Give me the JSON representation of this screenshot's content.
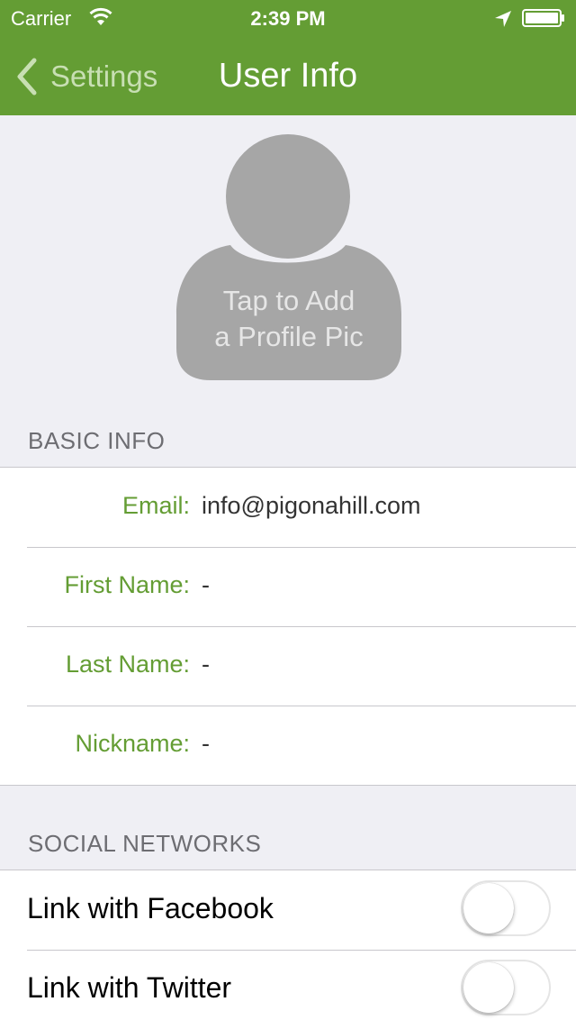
{
  "status_bar": {
    "carrier": "Carrier",
    "time": "2:39 PM"
  },
  "nav": {
    "back_label": "Settings",
    "title": "User Info"
  },
  "profile": {
    "placeholder_text": "Tap to Add\na Profile Pic"
  },
  "basic_info": {
    "header": "BASIC INFO",
    "rows": [
      {
        "label": "Email:",
        "value": "info@pigonahill.com"
      },
      {
        "label": "First Name:",
        "value": "-"
      },
      {
        "label": "Last Name:",
        "value": "-"
      },
      {
        "label": "Nickname:",
        "value": "-"
      }
    ]
  },
  "social": {
    "header": "SOCIAL NETWORKS",
    "rows": [
      {
        "label": "Link with Facebook",
        "on": false
      },
      {
        "label": "Link with Twitter",
        "on": false
      }
    ]
  },
  "colors": {
    "accent": "#649d34",
    "background": "#efeff4",
    "avatar_gray": "#a6a6a6"
  },
  "icons": [
    "wifi-icon",
    "location-arrow-icon",
    "battery-icon",
    "back-chevron-icon",
    "profile-placeholder-icon"
  ]
}
